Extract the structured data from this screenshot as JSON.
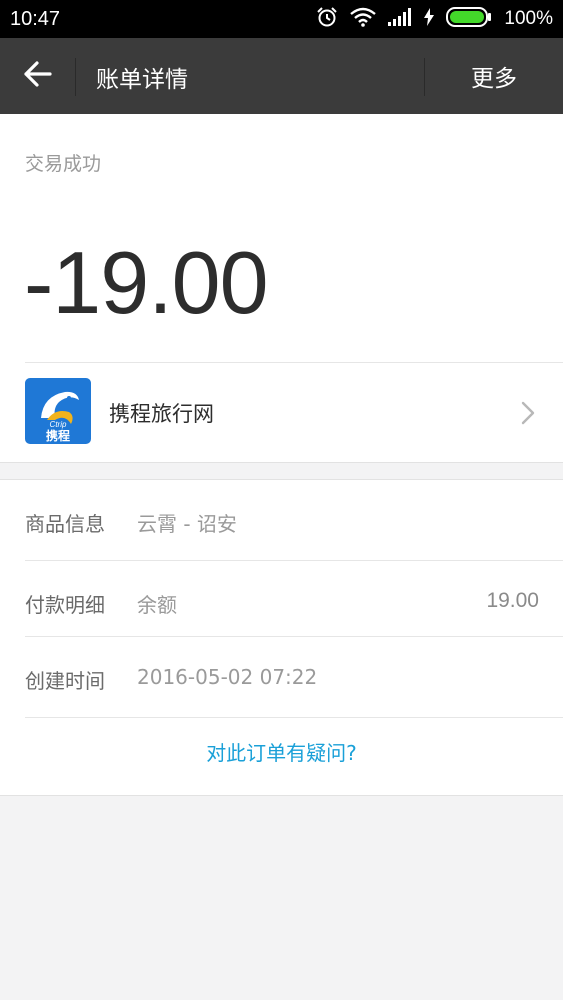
{
  "status_bar": {
    "time": "10:47",
    "battery": "100%",
    "icons": [
      "alarm-icon",
      "wifi-icon",
      "signal-icon",
      "charging-icon",
      "battery-icon"
    ]
  },
  "app_bar": {
    "title": "账单详情",
    "more_label": "更多",
    "back_icon": "back-arrow-icon"
  },
  "transaction": {
    "status": "交易成功",
    "amount": "-19.00"
  },
  "merchant": {
    "name": "携程旅行网",
    "logo_text": "携程",
    "logo_brand": "Ctrip",
    "chevron_icon": "chevron-right-icon"
  },
  "details": [
    {
      "label": "商品信息",
      "value": "云霄 - 诏安",
      "amount": ""
    },
    {
      "label": "付款明细",
      "value": "余额",
      "amount": "19.00"
    },
    {
      "label": "创建时间",
      "value": "2016-05-02 07:22",
      "amount": ""
    }
  ],
  "question_link": "对此订单有疑问?",
  "colors": {
    "app_bar_bg": "#3b3b3b",
    "link": "#1aa0d8",
    "logo_bg": "#1f78d6",
    "page_bg": "#f3f3f4"
  }
}
